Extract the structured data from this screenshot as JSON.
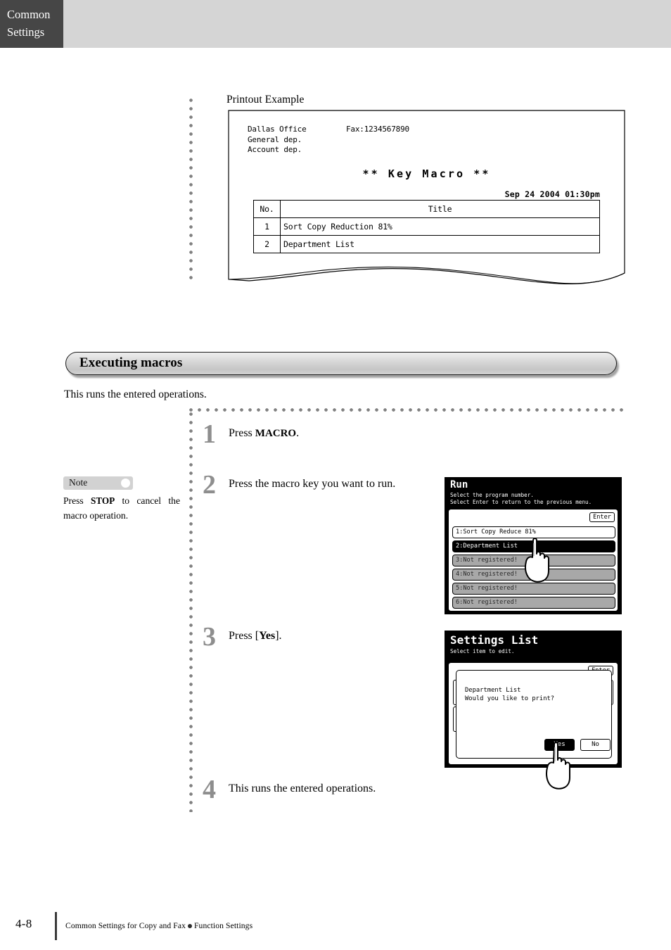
{
  "header": {
    "tab_line1": "Common",
    "tab_line2": "Settings"
  },
  "printout": {
    "caption": "Printout Example",
    "addr_line1": "Dallas Office",
    "addr_line2": "General dep.",
    "addr_line3": "Account dep.",
    "fax": "Fax:1234567890",
    "title": "** Key Macro **",
    "date": "Sep 24 2004 01:30pm",
    "table": {
      "headers": [
        "No.",
        "Title"
      ],
      "rows": [
        [
          "1",
          "Sort Copy Reduction 81%"
        ],
        [
          "2",
          "Department List"
        ]
      ]
    }
  },
  "section": {
    "heading": "Executing macros",
    "intro": "This runs the entered operations."
  },
  "note": {
    "badge_label": "Note",
    "text_pre": "Press ",
    "text_key": "STOP",
    "text_post": " to cancel the macro operation."
  },
  "steps": [
    {
      "number": "1",
      "text_pre": "Press ",
      "text_key": "MACRO",
      "text_post": "."
    },
    {
      "number": "2",
      "text_pre": "Press the macro key you want to run.",
      "text_key": "",
      "text_post": ""
    },
    {
      "number": "3",
      "text_pre": "Press [",
      "text_key": "Yes",
      "text_post": "]."
    },
    {
      "number": "4",
      "text_pre": "This runs the entered operations.",
      "text_key": "",
      "text_post": ""
    }
  ],
  "lcd_run": {
    "title": "Run",
    "sub_line1": "Select the program number.",
    "sub_line2": "Select Enter to return to the previous menu.",
    "enter_label": "Enter",
    "rows": [
      {
        "label": "1:Sort Copy Reduce 81%",
        "state": "white"
      },
      {
        "label": "2:Department List",
        "state": "selected"
      },
      {
        "label": "3:Not registered!",
        "state": "gray"
      },
      {
        "label": "4:Not registered!",
        "state": "gray"
      },
      {
        "label": "5:Not registered!",
        "state": "gray"
      },
      {
        "label": "6:Not registered!",
        "state": "gray"
      }
    ],
    "cursor_icon": "pointing-hand-icon"
  },
  "lcd_settings": {
    "title": "Settings List",
    "sub_line1": "Select item to edit.",
    "enter_label": "Enter",
    "dialog_line1": "Department List",
    "dialog_line2": "Would you like to print?",
    "yes_label": "Yes",
    "no_label": "No",
    "cursor_icon": "pointing-hand-icon"
  },
  "footer": {
    "page": "4-8",
    "text_left": "Common Settings for Copy and Fax",
    "text_right": "Function Settings"
  },
  "colors": {
    "tab_bg": "#464646",
    "band_bg": "#d5d5d5",
    "step_number": "#8e8e8e",
    "note_badge": "#d2d2d2",
    "lcd_bg": "#000000",
    "lcd_row_gray": "#a8a8a8"
  }
}
